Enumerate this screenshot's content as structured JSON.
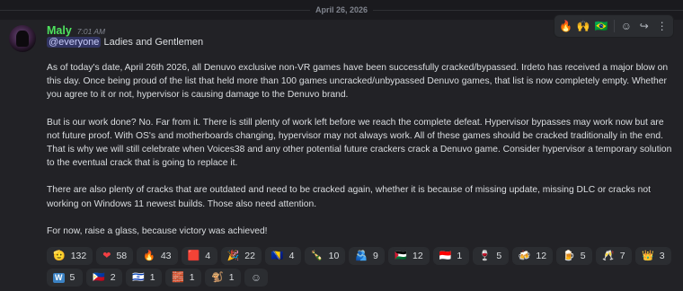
{
  "date_divider": "April 26, 2026",
  "message": {
    "username": "Maly",
    "timestamp": "7:01 AM",
    "mention": "@everyone",
    "greeting": " Ladies and Gentlemen",
    "paragraphs": [
      "As of today's date, April 26th 2026, all Denuvo exclusive non-VR games have been successfully cracked/bypassed. Irdeto has received a major blow on this day. Once being proud of the list that held more than 100 games uncracked/unbypassed Denuvo games, that list is now completely empty. Whether you agree to it or not, hypervisor is causing damage to the Denuvo brand.",
      "But is our work done? No. Far from it. There is still plenty of work left before we reach the complete defeat. Hypervisor bypasses may work now but are not future proof. With OS's and motherboards changing, hypervisor may not always work. All of these games should be cracked traditionally in the end. That is why we will still celebrate when Voices38 and any other potential future crackers crack a Denuvo game. Consider hypervisor a temporary solution to the eventual crack that is going to replace it.",
      "There are also plenty of cracks that are outdated and need to be cracked again, whether it is because of missing update, missing DLC or cracks not working on Windows 11 newest builds. Those also need attention.",
      "For now, raise a glass, because victory was achieved!"
    ]
  },
  "toolbar": {
    "items": [
      {
        "name": "fire-reaction-button",
        "glyph": "🔥"
      },
      {
        "name": "raised-hands-reaction-button",
        "glyph": "🙌"
      },
      {
        "name": "brazil-flag-reaction-button",
        "glyph": "🇧🇷"
      },
      {
        "name": "add-reaction-button",
        "glyph": "☺"
      },
      {
        "name": "forward-button",
        "glyph": "↪"
      },
      {
        "name": "more-options-button",
        "glyph": "⋮"
      }
    ]
  },
  "reactions": [
    {
      "emoji": "🫡",
      "count": "132"
    },
    {
      "emoji": "❤",
      "count": "58"
    },
    {
      "emoji": "🔥",
      "count": "43"
    },
    {
      "emoji": "🟥",
      "count": "4"
    },
    {
      "emoji": "🎉",
      "count": "22"
    },
    {
      "emoji": "🇧🇦",
      "count": "4"
    },
    {
      "emoji": "🍾",
      "count": "10"
    },
    {
      "emoji": "🫂",
      "count": "9"
    },
    {
      "emoji": "🇵🇸",
      "count": "12"
    },
    {
      "emoji": "🇮🇩",
      "count": "1"
    },
    {
      "emoji": "🍷",
      "count": "5"
    },
    {
      "emoji": "🍻",
      "count": "12"
    },
    {
      "emoji": "🍺",
      "count": "5"
    },
    {
      "emoji": "🥂",
      "count": "7"
    },
    {
      "emoji": "👑",
      "count": "3"
    },
    {
      "emoji": "W",
      "count": "5"
    },
    {
      "emoji": "🇵🇭",
      "count": "2"
    },
    {
      "emoji": "🇮🇱",
      "count": "1"
    },
    {
      "emoji": "🧱",
      "count": "1"
    },
    {
      "emoji": "🐒",
      "count": "1"
    }
  ]
}
